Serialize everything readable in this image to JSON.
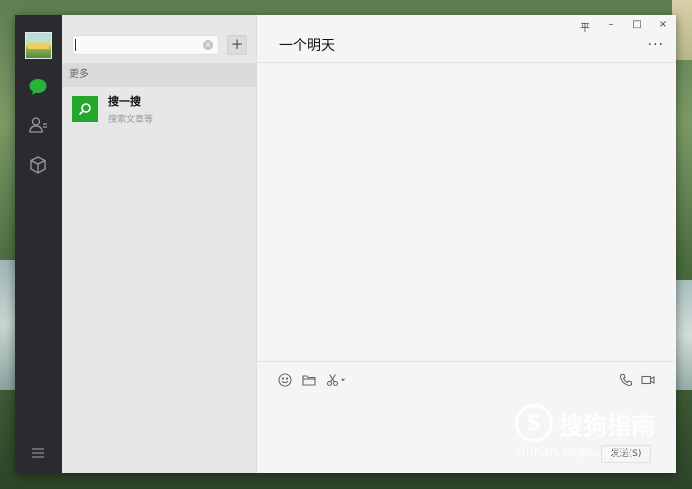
{
  "window": {
    "controls": {
      "pin": "平",
      "minimize": "–",
      "maximize": "□",
      "close": "×"
    }
  },
  "nav": {
    "items": [
      {
        "icon": "chat-icon",
        "active": true
      },
      {
        "icon": "contacts-icon",
        "active": false
      },
      {
        "icon": "favorites-icon",
        "active": false
      }
    ],
    "menu_icon": "menu-icon"
  },
  "search": {
    "value": "",
    "clear_glyph": "×",
    "add_glyph": "+"
  },
  "results": {
    "section_label": "更多",
    "items": [
      {
        "title": "搜一搜",
        "subtitle": "搜索文章等",
        "icon": "search-icon"
      }
    ]
  },
  "chat": {
    "title": "一个明天",
    "more_glyph": "···",
    "send_label": "发送(S)"
  },
  "watermark": {
    "logo": "S",
    "text": "搜狗指南",
    "url": "zhinan.sogou.com"
  },
  "colors": {
    "nav_bg": "#2b2a2e",
    "accent_green": "#24a72d",
    "list_bg": "#e8e7e7",
    "chat_bg": "#f5f5f5"
  }
}
